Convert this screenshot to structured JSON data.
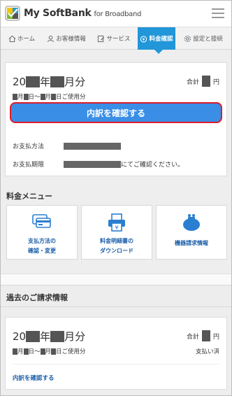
{
  "header": {
    "logo_main": "My SoftBank",
    "logo_sub": "for Broadband",
    "menu_icon": "hamburger-menu-icon"
  },
  "tabs": [
    {
      "label": "ホーム",
      "icon": "home-icon"
    },
    {
      "label": "お客様情報",
      "icon": "person-icon"
    },
    {
      "label": "サービス",
      "icon": "edit-icon"
    },
    {
      "label": "料金確認",
      "icon": "yen-clock-icon",
      "active": true
    },
    {
      "label": "設定と接続",
      "icon": "gear-icon"
    }
  ],
  "current_bill": {
    "month_prefix": "20",
    "year_suffix": "年",
    "month_suffix": "月分",
    "total_label": "合計",
    "total_unit": "円",
    "period_month1": "月",
    "period_day1": "日〜",
    "period_month2": "月",
    "period_day2": "日ご使用分",
    "details_button": "内訳を確認する",
    "payment_method_label": "お支払方法",
    "payment_due_label": "お支払期限",
    "payment_due_suffix": "にてご確認ください。"
  },
  "fee_menu": {
    "title": "料金メニュー",
    "items": [
      {
        "line1": "支払方法の",
        "line2": "確認・変更",
        "icon": "payment-card-icon"
      },
      {
        "line1": "料金明細書の",
        "line2": "ダウンロード",
        "icon": "printer-yen-icon"
      },
      {
        "line1": "機器請求情報",
        "line2": "",
        "icon": "purse-icon"
      }
    ]
  },
  "past_bills": {
    "title": "過去のご請求情報",
    "month_prefix": "20",
    "year_suffix": "年",
    "month_suffix": "月分",
    "total_label": "合計",
    "total_unit": "円",
    "period_month1": "月",
    "period_day1": "日〜",
    "period_month2": "月",
    "period_day2": "日ご使用分",
    "status": "支払い済",
    "link": "内訳を確認する"
  },
  "colors": {
    "accent": "#2196d9",
    "button": "#3a8ee6",
    "highlight_border": "#e01a2a",
    "link": "#1a5ea8"
  }
}
